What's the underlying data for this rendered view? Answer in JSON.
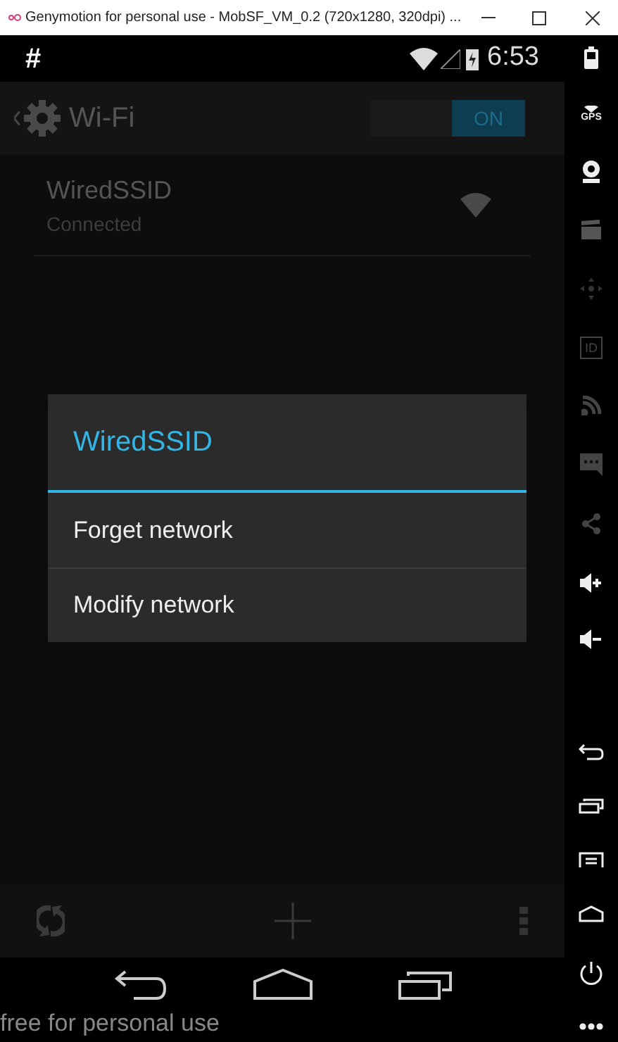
{
  "window": {
    "title": "Genymotion for personal use - MobSF_VM_0.2 (720x1280, 320dpi) ..."
  },
  "status_bar": {
    "notification": "#",
    "time": "6:53"
  },
  "action_bar": {
    "title": "Wi-Fi",
    "toggle": {
      "label": "ON",
      "on": true
    }
  },
  "networks": [
    {
      "name": "WiredSSID",
      "status": "Connected"
    }
  ],
  "dialog": {
    "title": "WiredSSID",
    "items": [
      "Forget network",
      "Modify network"
    ]
  },
  "overlay_text": "free for personal use",
  "side_toolbar": [
    {
      "kind": "battery"
    },
    {
      "kind": "gps",
      "label": "GPS"
    },
    {
      "kind": "camera"
    },
    {
      "kind": "video"
    },
    {
      "kind": "dpad"
    },
    {
      "kind": "id",
      "label": "ID"
    },
    {
      "kind": "rss"
    },
    {
      "kind": "sms"
    },
    {
      "kind": "share"
    },
    {
      "kind": "volup"
    },
    {
      "kind": "voldown"
    },
    {
      "kind": "spacer"
    },
    {
      "kind": "back"
    },
    {
      "kind": "recent"
    },
    {
      "kind": "menu"
    },
    {
      "kind": "home"
    },
    {
      "kind": "power"
    },
    {
      "kind": "more"
    }
  ]
}
